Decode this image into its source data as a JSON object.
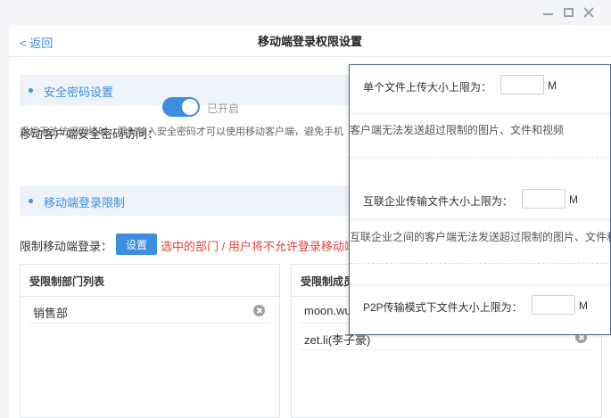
{
  "window": {
    "controls": {
      "minimize": "minimize-icon",
      "maximize": "maximize-icon",
      "close": "close-icon"
    }
  },
  "header": {
    "back_label": "< 返回",
    "title": "移动端登录权限设置"
  },
  "sections": {
    "security_password": {
      "title": "安全密码设置",
      "toggle_label": "移动客户端安全密码访问：",
      "toggle_on": true,
      "toggle_status": "已开启",
      "hint": "手机无法访问网络时，强制输入安全密码才可以使用移动客户端，避免手机"
    },
    "login_restriction": {
      "title": "移动端登录限制",
      "restrict_label": "限制移动端登录：",
      "set_button": "设置",
      "warning": "选中的部门 / 用户将不允许登录移动端"
    }
  },
  "dept_list": {
    "header": "受限制部门列表",
    "items": [
      "销售部"
    ]
  },
  "member_list": {
    "header": "受限制成员",
    "items": [
      "moon.wu",
      "zet.li(李子豪)"
    ]
  },
  "file_settings": {
    "upload": {
      "label": "单个文件上传大小上限为：",
      "value": "",
      "unit": "M",
      "desc": "客户端无法发送超过限制的图片、文件和视频"
    },
    "interconnect": {
      "label": "互联企业传输文件大小上限为：",
      "value": "",
      "unit": "M",
      "desc": "互联企业之间的客户端无法发送超过限制的图片、文件和"
    },
    "p2p": {
      "label": "P2P传输模式下文件大小上限为：",
      "value": "",
      "unit": "M"
    }
  },
  "colors": {
    "accent": "#3b8ee0",
    "warning": "#e5423b",
    "section_bg": "#eef3f9"
  }
}
